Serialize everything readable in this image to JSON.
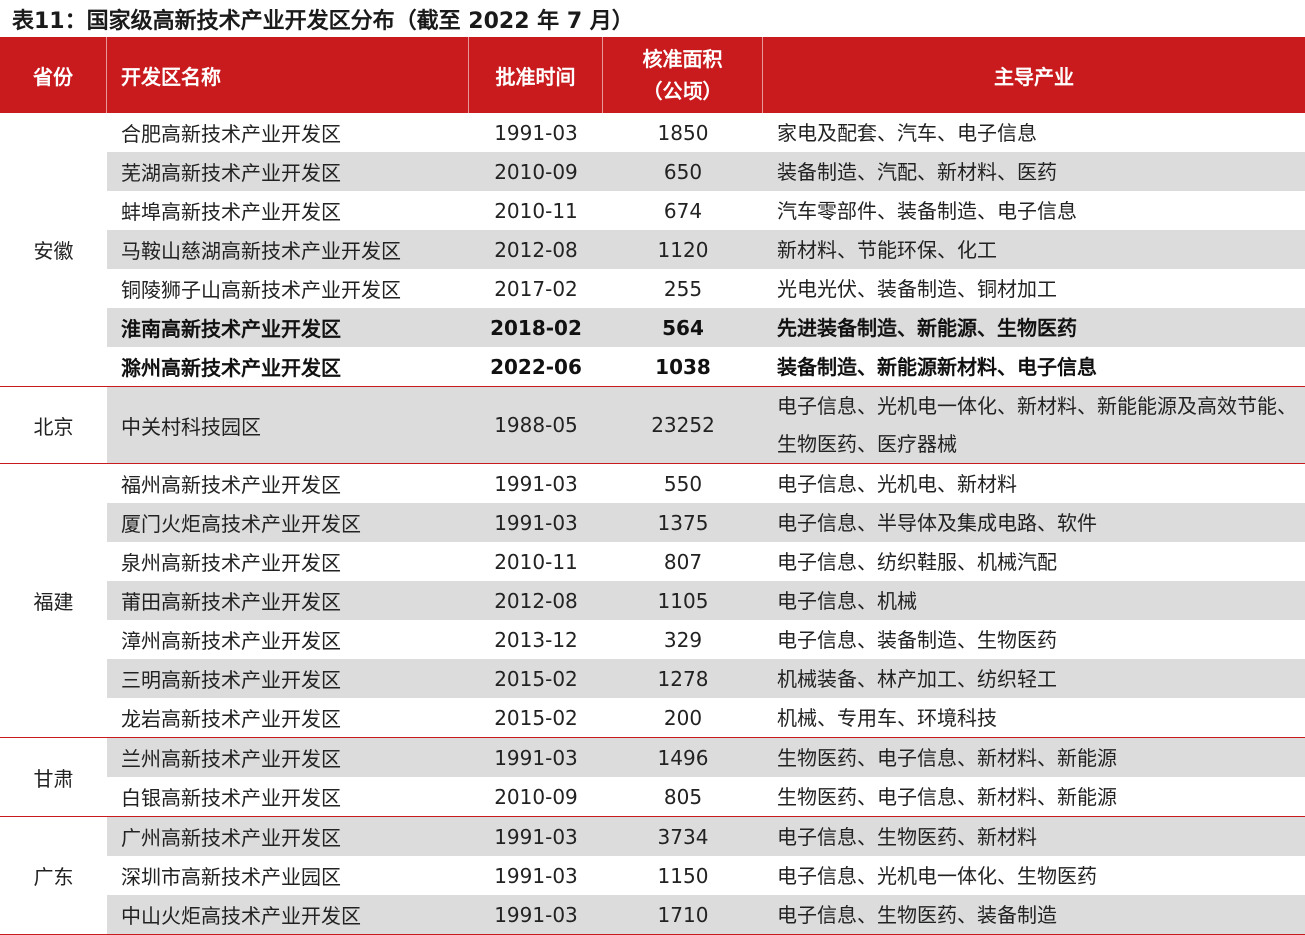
{
  "title": "表11：国家级高新技术产业开发区分布（截至 2022 年 7 月）",
  "header": {
    "province": "省份",
    "name": "开发区名称",
    "date": "批准时间",
    "area_line1": "核准面积",
    "area_line2": "（公顷）",
    "industry": "主导产业"
  },
  "colors": {
    "header_bg": "#c91b1e",
    "alt_row": "#dcdcdc",
    "divider": "#c91b1e"
  },
  "groups": [
    {
      "province": "安徽",
      "rows": [
        {
          "name": "合肥高新技术产业开发区",
          "date": "1991-03",
          "area": "1850",
          "industry": "家电及配套、汽车、电子信息"
        },
        {
          "name": "芜湖高新技术产业开发区",
          "date": "2010-09",
          "area": "650",
          "industry": "装备制造、汽配、新材料、医药"
        },
        {
          "name": "蚌埠高新技术产业开发区",
          "date": "2010-11",
          "area": "674",
          "industry": "汽车零部件、装备制造、电子信息"
        },
        {
          "name": "马鞍山慈湖高新技术产业开发区",
          "date": "2012-08",
          "area": "1120",
          "industry": "新材料、节能环保、化工"
        },
        {
          "name": "铜陵狮子山高新技术产业开发区",
          "date": "2017-02",
          "area": "255",
          "industry": "光电光伏、装备制造、铜材加工"
        },
        {
          "name": "淮南高新技术产业开发区",
          "date": "2018-02",
          "area": "564",
          "industry": "先进装备制造、新能源、生物医药"
        },
        {
          "name": "滁州高新技术产业开发区",
          "date": "2022-06",
          "area": "1038",
          "industry": "装备制造、新能源新材料、电子信息"
        }
      ]
    },
    {
      "province": "北京",
      "rows": [
        {
          "name": "中关村科技园区",
          "date": "1988-05",
          "area": "23252",
          "industry": "电子信息、光机电一体化、新材料、新能能源及高效节能、生物医药、医疗器械"
        }
      ]
    },
    {
      "province": "福建",
      "rows": [
        {
          "name": "福州高新技术产业开发区",
          "date": "1991-03",
          "area": "550",
          "industry": "电子信息、光机电、新材料"
        },
        {
          "name": "厦门火炬高技术产业开发区",
          "date": "1991-03",
          "area": "1375",
          "industry": "电子信息、半导体及集成电路、软件"
        },
        {
          "name": "泉州高新技术产业开发区",
          "date": "2010-11",
          "area": "807",
          "industry": "电子信息、纺织鞋服、机械汽配"
        },
        {
          "name": "莆田高新技术产业开发区",
          "date": "2012-08",
          "area": "1105",
          "industry": "电子信息、机械"
        },
        {
          "name": "漳州高新技术产业开发区",
          "date": "2013-12",
          "area": "329",
          "industry": "电子信息、装备制造、生物医药"
        },
        {
          "name": "三明高新技术产业开发区",
          "date": "2015-02",
          "area": "1278",
          "industry": "机械装备、林产加工、纺织轻工"
        },
        {
          "name": "龙岩高新技术产业开发区",
          "date": "2015-02",
          "area": "200",
          "industry": "机械、专用车、环境科技"
        }
      ]
    },
    {
      "province": "甘肃",
      "rows": [
        {
          "name": "兰州高新技术产业开发区",
          "date": "1991-03",
          "area": "1496",
          "industry": "生物医药、电子信息、新材料、新能源"
        },
        {
          "name": "白银高新技术产业开发区",
          "date": "2010-09",
          "area": "805",
          "industry": "生物医药、电子信息、新材料、新能源"
        }
      ]
    },
    {
      "province": "广东",
      "rows": [
        {
          "name": "广州高新技术产业开发区",
          "date": "1991-03",
          "area": "3734",
          "industry": "电子信息、生物医药、新材料"
        },
        {
          "name": "深圳市高新技术产业园区",
          "date": "1991-03",
          "area": "1150",
          "industry": "电子信息、光机电一体化、生物医药"
        },
        {
          "name": "中山火炬高技术产业开发区",
          "date": "1991-03",
          "area": "1710",
          "industry": "电子信息、生物医药、装备制造"
        }
      ]
    }
  ]
}
